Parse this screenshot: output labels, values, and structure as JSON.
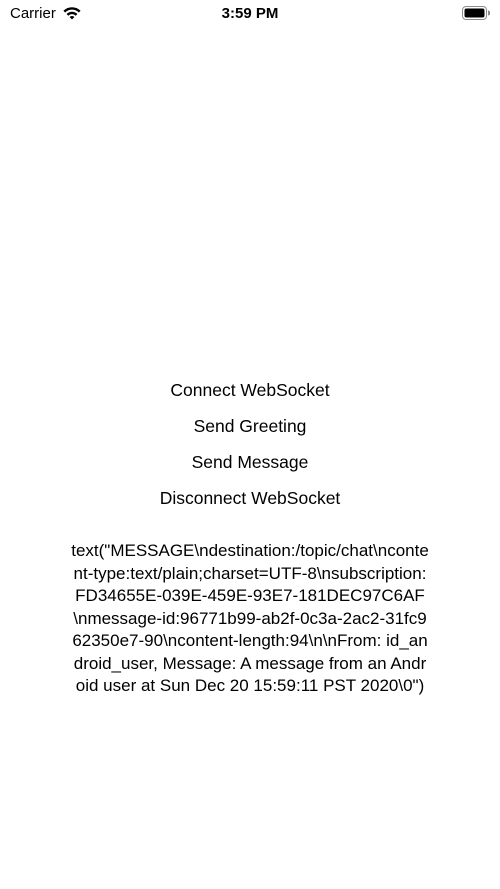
{
  "status_bar": {
    "carrier": "Carrier",
    "time": "3:59 PM",
    "icons": [
      "wifi-icon",
      "battery-icon"
    ]
  },
  "actions": {
    "connect_label": "Connect WebSocket",
    "send_greeting_label": "Send Greeting",
    "send_message_label": "Send Message",
    "disconnect_label": "Disconnect WebSocket"
  },
  "message": {
    "text": "text(\"MESSAGE\\ndestination:/topic/chat\\ncontent-type:text/plain;charset=UTF-8\\nsubscription:FD34655E-039E-459E-93E7-181DEC97C6AF\\nmessage-id:96771b99-ab2f-0c3a-2ac2-31fc962350e7-90\\ncontent-length:94\\n\\nFrom: id_android_user, Message: A message from an Android user at Sun Dec 20 15:59:11 PST 2020\\0\")"
  }
}
